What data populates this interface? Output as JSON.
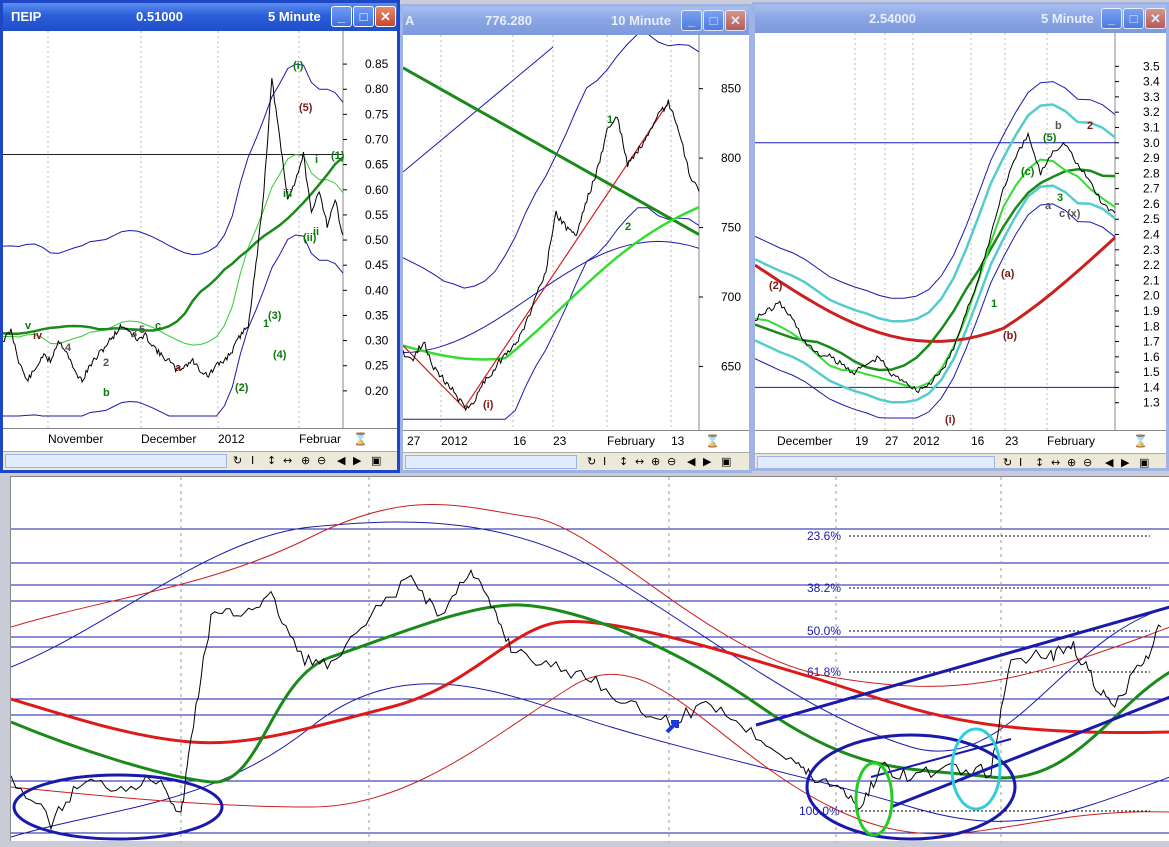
{
  "windows": [
    {
      "id": "w1",
      "symbol": "ΠΕΙΡ",
      "price": "0.51000",
      "interval": "5 Minute",
      "y_ticks": [
        "0.85",
        "0.80",
        "0.75",
        "0.70",
        "0.65",
        "0.60",
        "0.55",
        "0.50",
        "0.45",
        "0.40",
        "0.35",
        "0.30",
        "0.25",
        "0.20"
      ],
      "x_labels": [
        "November",
        "December",
        "2012",
        "Februar"
      ],
      "wave_labels": [
        "(i)",
        "(ii)",
        "i",
        "ii",
        "iii",
        "iv",
        "v",
        "a",
        "b",
        "c",
        "(1)",
        "(2)",
        "(3)",
        "(4)",
        "(5)",
        "1",
        "2",
        "3",
        "4",
        "5"
      ]
    },
    {
      "id": "w2",
      "symbol": "A",
      "price": "776.280",
      "interval": "10 Minute",
      "y_ticks": [
        "850",
        "800",
        "750",
        "700",
        "650"
      ],
      "x_labels": [
        "27",
        "2012",
        "16",
        "23",
        "February",
        "13"
      ],
      "wave_labels": [
        "(i)",
        "1",
        "2"
      ]
    },
    {
      "id": "w3",
      "symbol": "",
      "price": "2.54000",
      "interval": "5 Minute",
      "y_ticks": [
        "3.5",
        "3.4",
        "3.3",
        "3.2",
        "3.1",
        "3.0",
        "2.9",
        "2.8",
        "2.7",
        "2.6",
        "2.5",
        "2.4",
        "2.3",
        "2.2",
        "2.1",
        "2.0",
        "1.9",
        "1.8",
        "1.7",
        "1.6",
        "1.5",
        "1.4",
        "1.3"
      ],
      "x_labels": [
        "December",
        "19",
        "27",
        "2012",
        "16",
        "23",
        "February"
      ],
      "wave_labels": [
        "(5)",
        "(c)",
        "(a)",
        "(b)",
        "(2)",
        "(i)",
        "1",
        "2",
        "3",
        "a",
        "b",
        "c",
        "(x)"
      ]
    }
  ],
  "nav_controls": [
    "↻",
    "I",
    "↕",
    "↔",
    "⊕",
    "⊖",
    "◀",
    "▶",
    "▣"
  ],
  "main_chart": {
    "fib_labels": [
      "23.6%",
      "38.2%",
      "50.0%",
      "61.8%",
      "100.0%"
    ]
  },
  "chart_data": [
    {
      "type": "line",
      "title": "ΠΕΙΡ 5 Minute",
      "ylim": [
        0.15,
        0.88
      ],
      "series_close": [
        0.3,
        0.32,
        0.26,
        0.22,
        0.24,
        0.27,
        0.26,
        0.3,
        0.28,
        0.24,
        0.22,
        0.25,
        0.27,
        0.29,
        0.31,
        0.33,
        0.32,
        0.3,
        0.31,
        0.29,
        0.27,
        0.26,
        0.24,
        0.25,
        0.26,
        0.24,
        0.23,
        0.25,
        0.26,
        0.28,
        0.31,
        0.33,
        0.45,
        0.6,
        0.82,
        0.7,
        0.58,
        0.62,
        0.67,
        0.55,
        0.6,
        0.53,
        0.58,
        0.51
      ],
      "colors": {
        "price": "#000000",
        "ma_slow": "#1a8a1a",
        "bands": "#1a1aaa",
        "ma_fast": "#33cc33"
      }
    },
    {
      "type": "line",
      "title": "10 Minute",
      "ylim": [
        610,
        880
      ],
      "series_close": [
        660,
        655,
        668,
        650,
        640,
        632,
        620,
        625,
        640,
        648,
        660,
        665,
        680,
        700,
        720,
        760,
        750,
        745,
        770,
        790,
        820,
        830,
        795,
        805,
        815,
        830,
        840,
        820,
        790,
        776
      ]
    },
    {
      "type": "line",
      "title": "5 Minute",
      "ylim": [
        1.2,
        3.6
      ],
      "series_close": [
        1.85,
        1.9,
        1.95,
        1.85,
        1.7,
        1.62,
        1.6,
        1.55,
        1.5,
        1.55,
        1.6,
        1.48,
        1.45,
        1.38,
        1.42,
        1.5,
        1.65,
        1.9,
        2.1,
        2.4,
        2.7,
        2.9,
        3.05,
        2.8,
        2.95,
        3.0,
        2.85,
        2.75,
        2.6,
        2.54
      ]
    }
  ]
}
